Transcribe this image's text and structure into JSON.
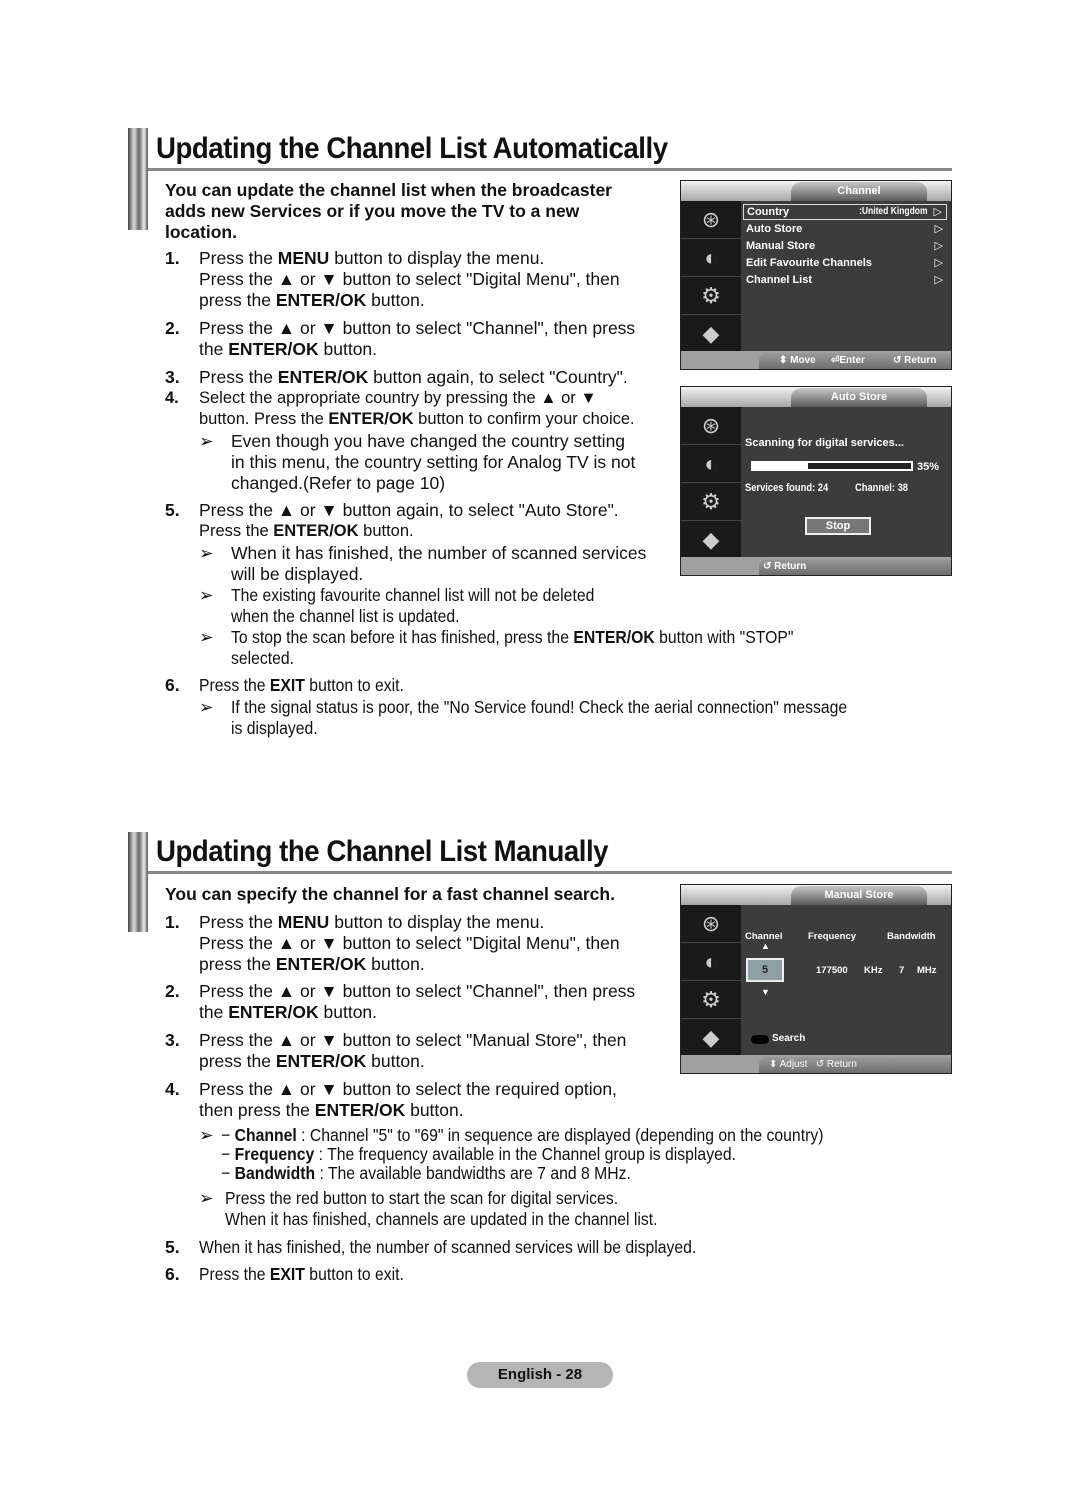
{
  "section1": {
    "title": "Updating the Channel List Automatically",
    "intro": [
      "You can update the channel list when the broadcaster",
      "adds new Services or if you move the TV to a new",
      "location."
    ],
    "steps": [
      {
        "num": "1.",
        "lines": [
          "Press the <b>MENU</b> button to display the menu.",
          "Press the ▲ or ▼ button to select \"Digital Menu\", then",
          "press the <b>ENTER/OK</b> button."
        ]
      },
      {
        "num": "2.",
        "lines": [
          "Press the ▲ or ▼ button to select \"Channel\", then press",
          "the <b>ENTER/OK</b> button."
        ]
      },
      {
        "num": "3.",
        "lines": [
          "Press the <b>ENTER/OK</b> button again, to select \"Country\"."
        ]
      },
      {
        "num": "4.",
        "lines": [
          "Select the appropriate country by pressing the ▲ or ▼",
          "button. Press the <b>ENTER/OK</b> button to confirm your choice."
        ]
      },
      {
        "num": "5.",
        "lines": [
          "Press the ▲ or ▼ button again, to select \"Auto Store\".",
          "Press the <b>ENTER/OK</b> button."
        ]
      },
      {
        "num": "6.",
        "lines": [
          "Press the <b>EXIT</b> button to exit."
        ]
      }
    ],
    "notes": {
      "n4": [
        "Even though you have changed the country setting",
        "in this menu, the country setting for Analog TV is not",
        "changed.(Refer to page 10)"
      ],
      "n5a": [
        "When it has finished, the number of scanned services",
        "will be displayed."
      ],
      "n5b": [
        "The existing favourite channel list will not be deleted",
        "when the channel list is updated."
      ],
      "n5c": [
        "To stop the scan before it has finished, press the <b>ENTER/OK</b> button with \"STOP\"",
        "selected."
      ],
      "n6": [
        "If the signal status is poor, the \"No Service found! Check the aerial connection\" message",
        "is displayed."
      ]
    }
  },
  "osd_channel": {
    "title": "Channel",
    "items": [
      {
        "label": "Country",
        "value": ":United Kingdom",
        "arrow": "▷",
        "selected": true
      },
      {
        "label": "Auto Store",
        "value": "",
        "arrow": "▷"
      },
      {
        "label": "Manual Store",
        "value": "",
        "arrow": "▷"
      },
      {
        "label": "Edit Favourite Channels",
        "value": "",
        "arrow": "▷"
      },
      {
        "label": "Channel List",
        "value": "",
        "arrow": "▷"
      }
    ],
    "footer": {
      "move": "⬍ Move",
      "enter": "⏎Enter",
      "return": "↺ Return"
    }
  },
  "osd_autostore": {
    "title": "Auto Store",
    "scanning": "Scanning for digital services...",
    "progress_percent": 35,
    "progress_label": "35%",
    "services_found": "Services found: 24",
    "channel": "Channel: 38",
    "stop": "Stop",
    "footer_return": "↺ Return"
  },
  "section2": {
    "title": "Updating the Channel List Manually",
    "intro": "You can specify the channel for a fast channel search.",
    "steps": [
      {
        "num": "1.",
        "lines": [
          "Press the <b>MENU</b> button to display the menu.",
          "Press the ▲ or ▼ button to select \"Digital Menu\", then",
          "press the <b>ENTER/OK</b> button."
        ]
      },
      {
        "num": "2.",
        "lines": [
          "Press the ▲ or ▼ button to select \"Channel\", then press",
          "the <b>ENTER/OK</b> button."
        ]
      },
      {
        "num": "3.",
        "lines": [
          "Press the ▲ or ▼ button to select \"Manual Store\", then",
          "press the <b>ENTER/OK</b> button."
        ]
      },
      {
        "num": "4.",
        "lines": [
          "Press the ▲ or ▼ button to select  the required option,",
          "then press the <b>ENTER/OK</b> button."
        ]
      },
      {
        "num": "5.",
        "lines": [
          "When it has finished, the number of scanned services will be displayed."
        ]
      },
      {
        "num": "6.",
        "lines": [
          "Press the <b>EXIT</b> button to exit."
        ]
      }
    ],
    "notes": {
      "options": [
        "− <b>Channel</b> : Channel \"5\" to \"69\" in sequence are displayed (depending on the country)",
        "− <b>Frequency</b> : The frequency available in the Channel group is displayed.",
        "− <b>Bandwidth</b> : The available bandwidths are 7 and 8 MHz."
      ],
      "red": [
        "Press the red button to start the scan for digital services.",
        "When it has finished, channels are updated in the channel list."
      ]
    }
  },
  "osd_manual": {
    "title": "Manual Store",
    "col_channel": "Channel",
    "col_frequency": "Frequency",
    "col_bandwidth": "Bandwidth",
    "channel_value": "5",
    "frequency_value": "177500",
    "frequency_unit": "KHz",
    "bandwidth_value": "7",
    "bandwidth_unit": "MHz",
    "search": "Search",
    "footer": "⬍ Adjust   ↺ Return"
  },
  "footer": {
    "page_label": "English - 28"
  },
  "arrow_glyph": "➢"
}
